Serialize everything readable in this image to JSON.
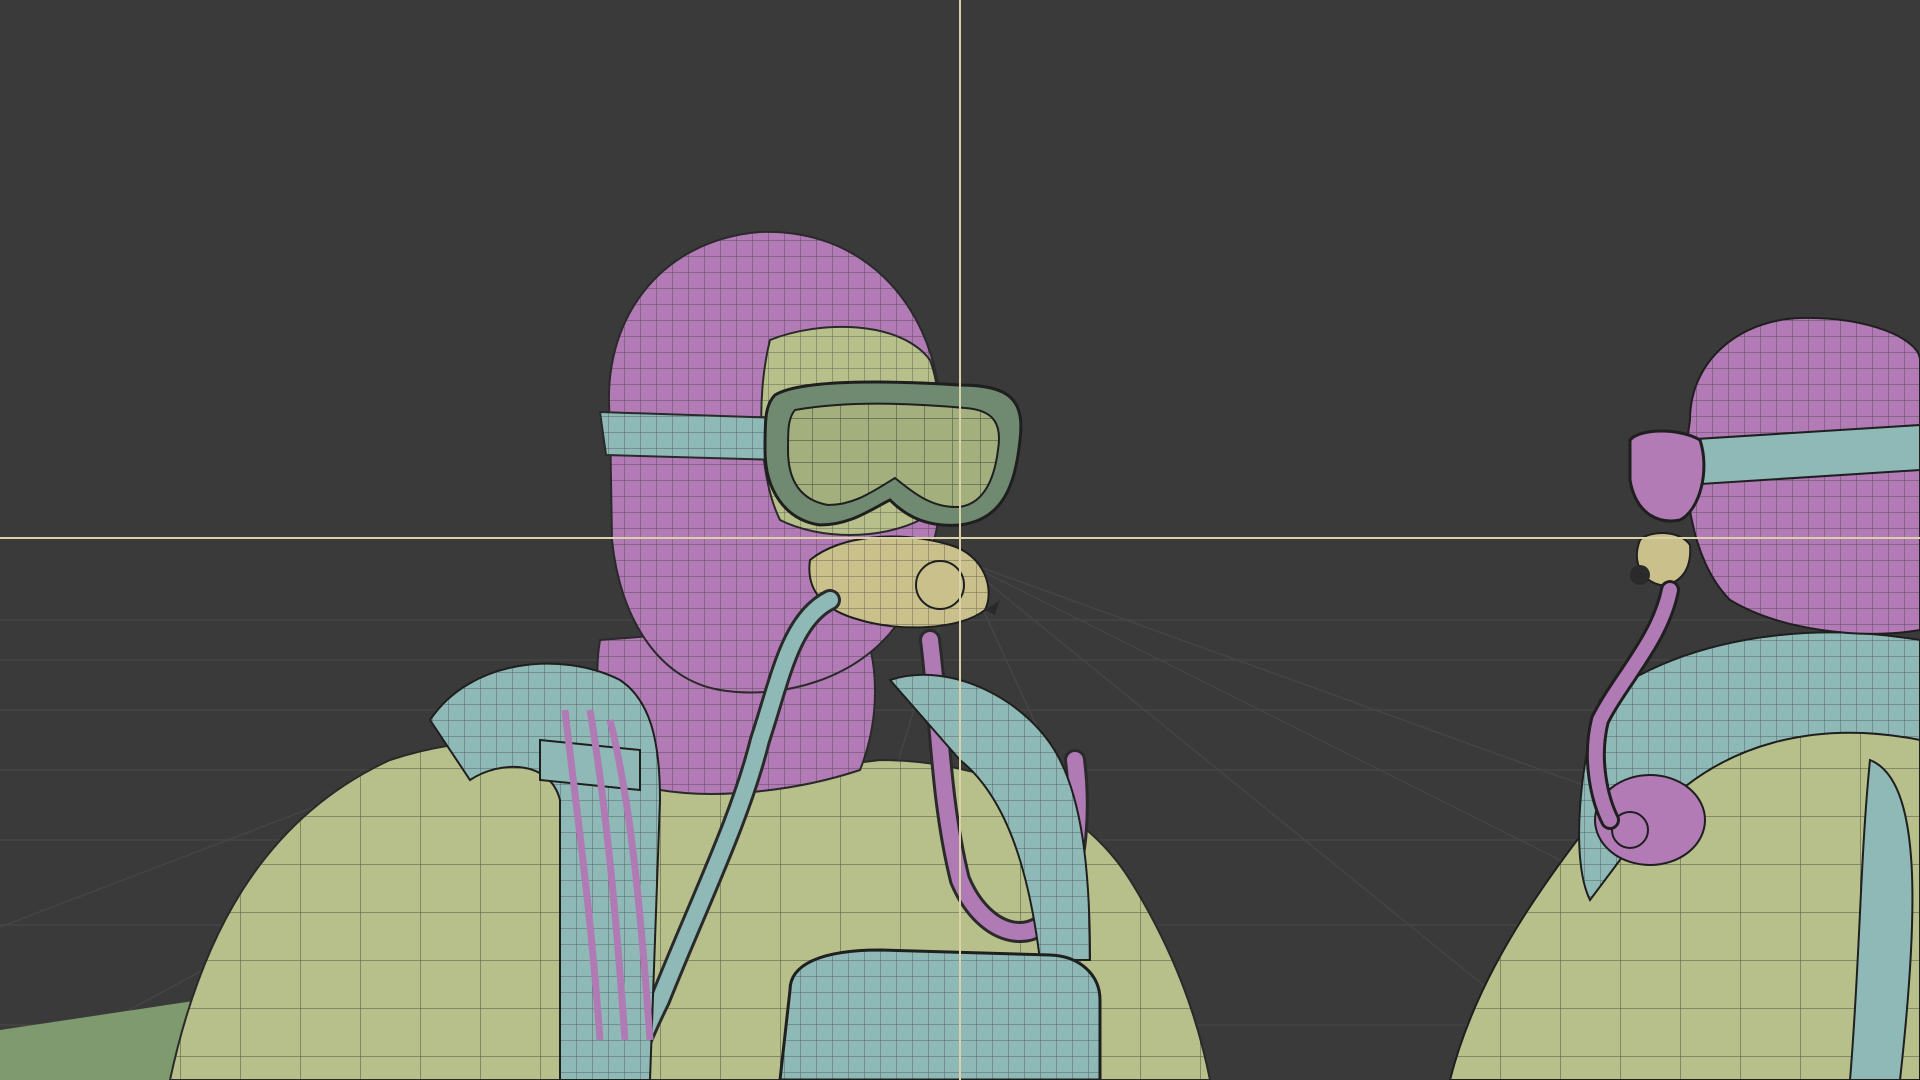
{
  "viewport": {
    "mode": "3d-viewport",
    "shading": "solid-wireframe-overlay",
    "background_color": "#3a3a3a",
    "grid_color": "#4a4a4a",
    "crosshair_color": "#d9d2a8"
  },
  "scene": {
    "objects": [
      {
        "name": "diver-left",
        "parts": [
          "hood",
          "dive-mask",
          "mask-strap",
          "regulator",
          "hose",
          "harness",
          "suit",
          "chest-pack"
        ]
      },
      {
        "name": "diver-right",
        "parts": [
          "hood",
          "dive-mask",
          "mask-strap",
          "regulator",
          "hose",
          "harness",
          "suit",
          "shoulder-valve"
        ]
      }
    ],
    "material_colors": {
      "hood": "#b27bb6",
      "suit": "#b7c08a",
      "harness": "#8fb9b6",
      "mask_lens": "#a3b07e",
      "regulator": "#c9c08c",
      "hose_pink": "#b07ab4",
      "hose_cyan": "#8fb9b6",
      "ground": "#7f9a6e"
    }
  }
}
